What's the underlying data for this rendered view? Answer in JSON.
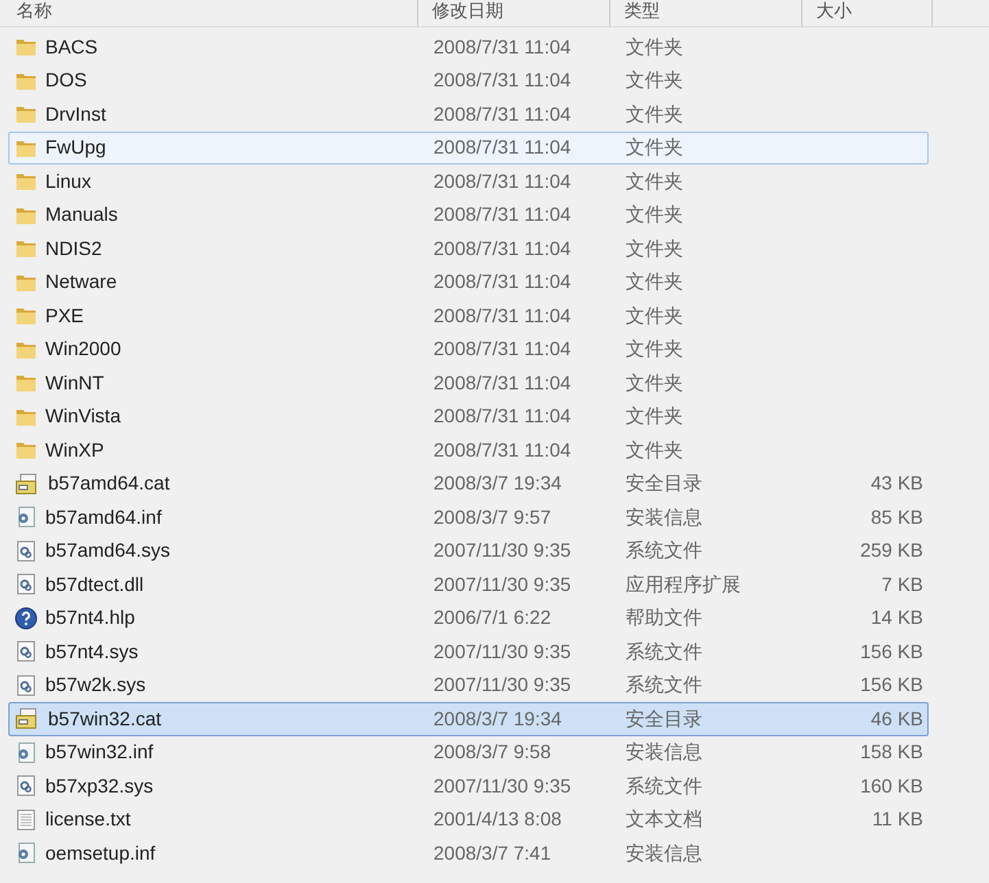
{
  "columns": [
    "名称",
    "修改日期",
    "类型",
    "大小"
  ],
  "rows": [
    {
      "kind": "folder",
      "name": "BACS",
      "date": "2008/7/31 11:04",
      "type": "文件夹",
      "selected": false,
      "hovered": false
    },
    {
      "kind": "folder",
      "name": "DOS",
      "date": "2008/7/31 11:04",
      "type": "文件夹",
      "selected": false,
      "hovered": false
    },
    {
      "kind": "folder",
      "name": "DrvInst",
      "date": "2008/7/31 11:04",
      "type": "文件夹",
      "selected": false,
      "hovered": false
    },
    {
      "kind": "folder",
      "name": "FwUpg",
      "date": "2008/7/31 11:04",
      "type": "文件夹",
      "selected": false,
      "hovered": true
    },
    {
      "kind": "folder",
      "name": "Linux",
      "date": "2008/7/31 11:04",
      "type": "文件夹",
      "selected": false,
      "hovered": false
    },
    {
      "kind": "folder",
      "name": "Manuals",
      "date": "2008/7/31 11:04",
      "type": "文件夹",
      "selected": false,
      "hovered": false
    },
    {
      "kind": "folder",
      "name": "NDIS2",
      "date": "2008/7/31 11:04",
      "type": "文件夹",
      "selected": false,
      "hovered": false
    },
    {
      "kind": "folder",
      "name": "Netware",
      "date": "2008/7/31 11:04",
      "type": "文件夹",
      "selected": false,
      "hovered": false
    },
    {
      "kind": "folder",
      "name": "PXE",
      "date": "2008/7/31 11:04",
      "type": "文件夹",
      "selected": false,
      "hovered": false
    },
    {
      "kind": "folder",
      "name": "Win2000",
      "date": "2008/7/31 11:04",
      "type": "文件夹",
      "selected": false,
      "hovered": false
    },
    {
      "kind": "folder",
      "name": "WinNT",
      "date": "2008/7/31 11:04",
      "type": "文件夹",
      "selected": false,
      "hovered": false
    },
    {
      "kind": "folder",
      "name": "WinVista",
      "date": "2008/7/31 11:04",
      "type": "文件夹",
      "selected": false,
      "hovered": false
    },
    {
      "kind": "folder",
      "name": "WinXP",
      "date": "2008/7/31 11:04",
      "type": "文件夹",
      "selected": false,
      "hovered": false
    },
    {
      "kind": "catalog",
      "name": "b57amd64.cat",
      "date": "2008/3/7 19:34",
      "type": "安全目录",
      "size": "43 KB",
      "selected": false,
      "hovered": false
    },
    {
      "kind": "setup",
      "name": "b57amd64.inf",
      "date": "2008/3/7 9:57",
      "type": "安装信息",
      "size": "85 KB",
      "selected": false,
      "hovered": false
    },
    {
      "kind": "system",
      "name": "b57amd64.sys",
      "date": "2007/11/30 9:35",
      "type": "系统文件",
      "size": "259 KB",
      "selected": false,
      "hovered": false
    },
    {
      "kind": "system",
      "name": "b57dtect.dll",
      "date": "2007/11/30 9:35",
      "type": "应用程序扩展",
      "size": "7 KB",
      "selected": false,
      "hovered": false
    },
    {
      "kind": "help",
      "name": "b57nt4.hlp",
      "date": "2006/7/1 6:22",
      "type": "帮助文件",
      "size": "14 KB",
      "selected": false,
      "hovered": false
    },
    {
      "kind": "system",
      "name": "b57nt4.sys",
      "date": "2007/11/30 9:35",
      "type": "系统文件",
      "size": "156 KB",
      "selected": false,
      "hovered": false
    },
    {
      "kind": "system",
      "name": "b57w2k.sys",
      "date": "2007/11/30 9:35",
      "type": "系统文件",
      "size": "156 KB",
      "selected": false,
      "hovered": false
    },
    {
      "kind": "catalog",
      "name": "b57win32.cat",
      "date": "2008/3/7 19:34",
      "type": "安全目录",
      "size": "46 KB",
      "selected": true,
      "hovered": false
    },
    {
      "kind": "setup",
      "name": "b57win32.inf",
      "date": "2008/3/7 9:58",
      "type": "安装信息",
      "size": "158 KB",
      "selected": false,
      "hovered": false
    },
    {
      "kind": "system",
      "name": "b57xp32.sys",
      "date": "2007/11/30 9:35",
      "type": "系统文件",
      "size": "160 KB",
      "selected": false,
      "hovered": false
    },
    {
      "kind": "text",
      "name": "license.txt",
      "date": "2001/4/13 8:08",
      "type": "文本文档",
      "size": "11 KB",
      "selected": false,
      "hovered": false
    },
    {
      "kind": "setup",
      "name": "oemsetup.inf",
      "date": "2008/3/7 7:41",
      "type": "安装信息",
      "selected": false,
      "hovered": false
    }
  ]
}
